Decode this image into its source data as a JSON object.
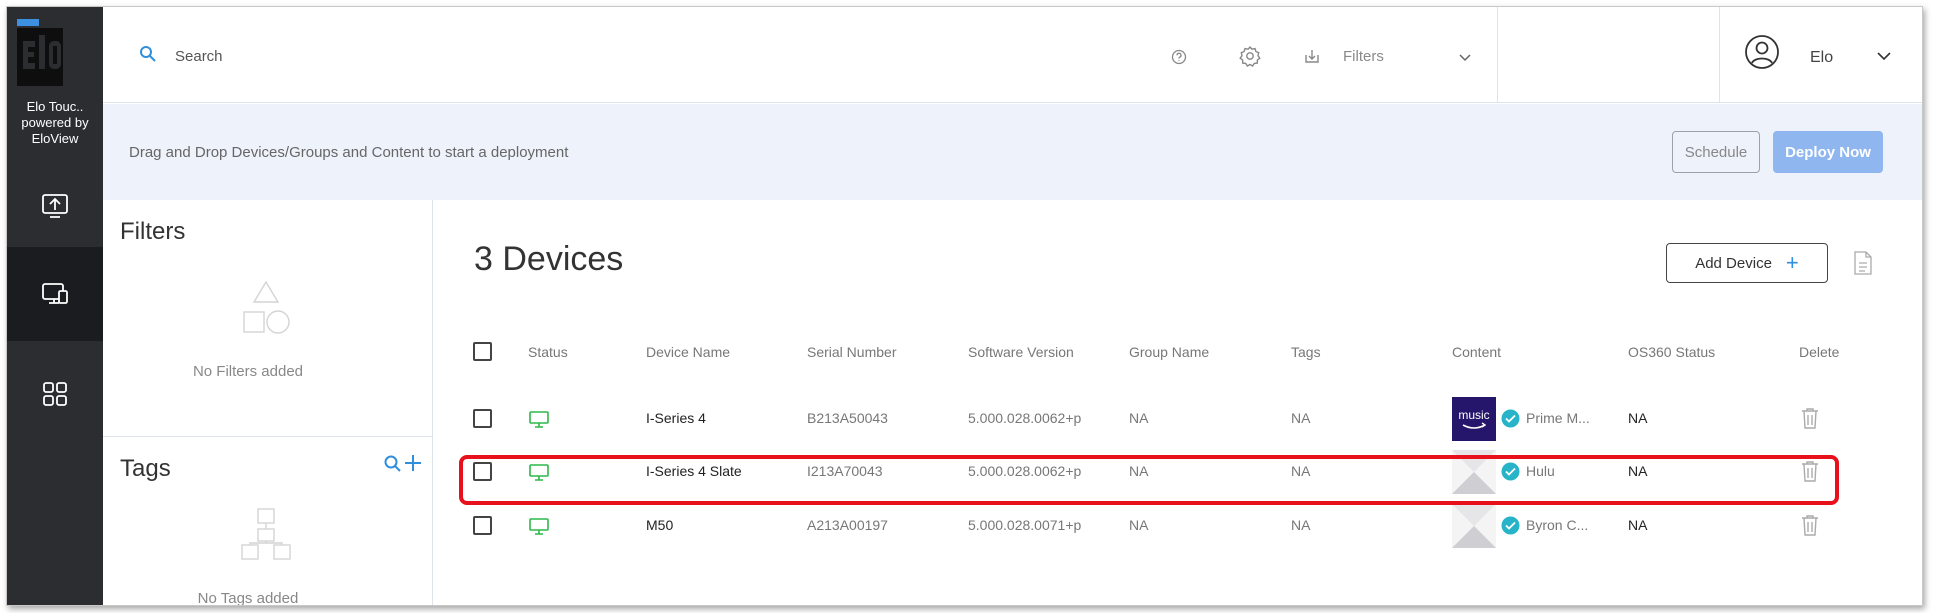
{
  "sidebar": {
    "brand_line1": "Elo Touc..",
    "brand_line2": "powered by",
    "brand_line3": "EloView",
    "items": [
      {
        "icon": "upload-icon"
      },
      {
        "icon": "devices-icon",
        "active": true
      },
      {
        "icon": "apps-grid-icon"
      }
    ]
  },
  "header": {
    "search_placeholder": "Search",
    "filters_label": "Filters",
    "user_name": "Elo"
  },
  "deploy": {
    "hint": "Drag and Drop Devices/Groups and Content to start a deployment",
    "schedule_label": "Schedule",
    "deploy_now_label": "Deploy Now"
  },
  "filters_panel": {
    "title": "Filters",
    "empty": "No Filters added"
  },
  "tags_panel": {
    "title": "Tags",
    "empty": "No Tags added"
  },
  "main": {
    "title": "3 Devices",
    "add_device_label": "Add Device",
    "columns": [
      "Status",
      "Device Name",
      "Serial Number",
      "Software Version",
      "Group Name",
      "Tags",
      "Content",
      "OS360 Status",
      "Delete"
    ],
    "rows": [
      {
        "name": "I-Series 4",
        "serial": "B213A50043",
        "software": "5.000.028.0062+p",
        "group": "NA",
        "tags": "NA",
        "content": "Prime M...",
        "content_thumb": "music",
        "os360": "NA"
      },
      {
        "name": "I-Series 4 Slate",
        "serial": "I213A70043",
        "software": "5.000.028.0062+p",
        "group": "NA",
        "tags": "NA",
        "content": "Hulu",
        "content_thumb": "",
        "os360": "NA"
      },
      {
        "name": "M50",
        "serial": "A213A00197",
        "software": "5.000.028.0071+p",
        "group": "NA",
        "tags": "NA",
        "content": "Byron C...",
        "content_thumb": "",
        "os360": "NA"
      }
    ]
  },
  "colors": {
    "nav_bg": "#2b2d31",
    "accent_blue": "#2f8fdc",
    "status_green": "#2db84a",
    "deploy_button": "#8fb6ef",
    "highlight_red": "#e8111b"
  }
}
